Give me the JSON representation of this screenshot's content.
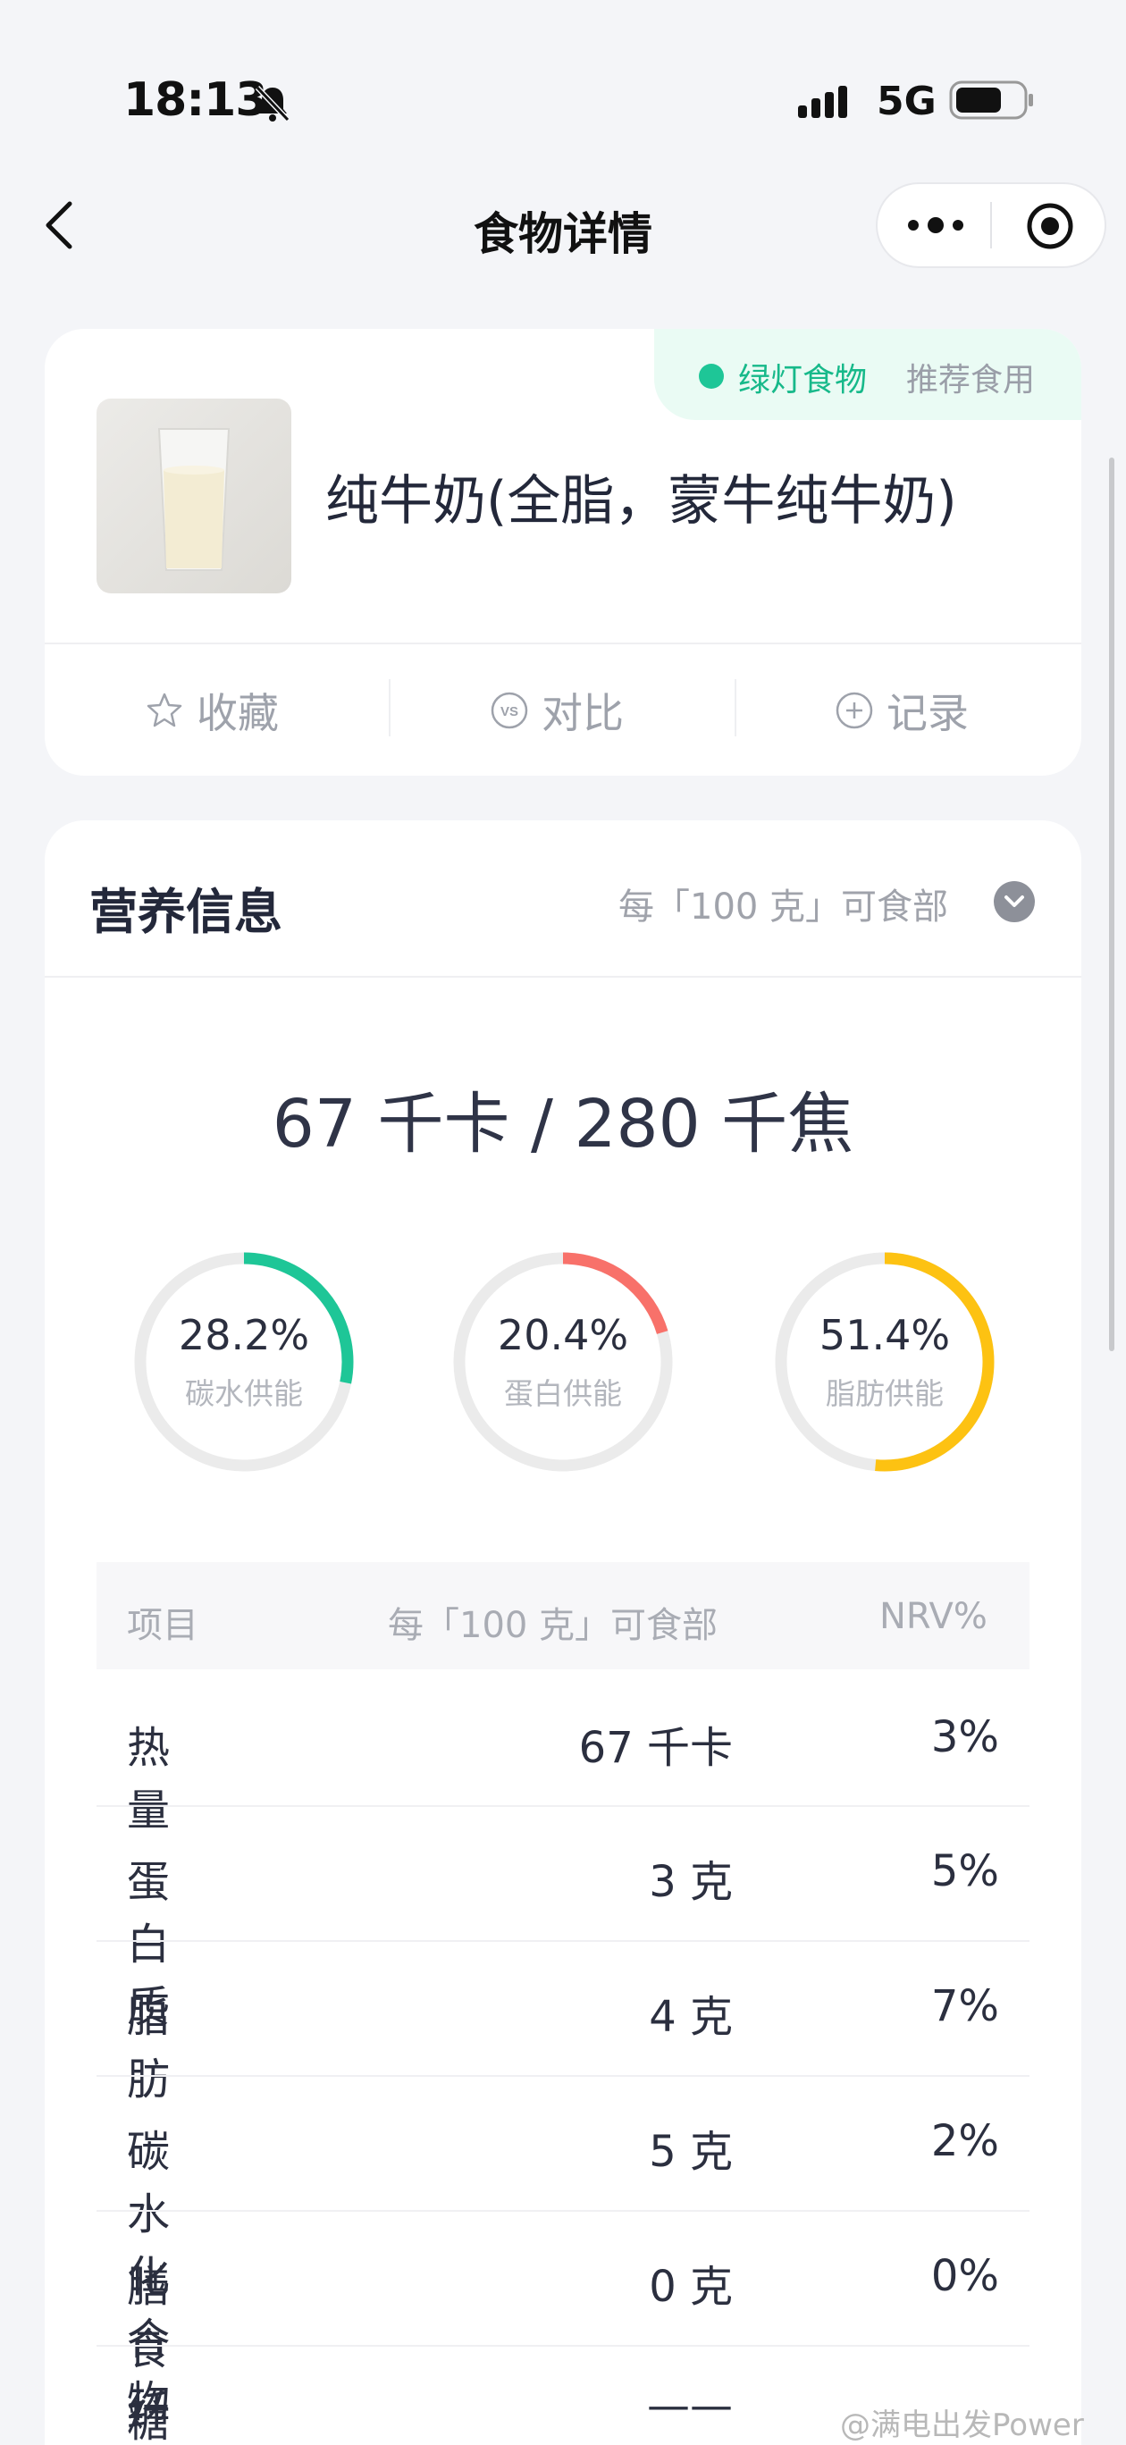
{
  "status_bar": {
    "time": "18:13",
    "network": "5G",
    "icons": [
      "bell-muted-icon",
      "signal-icon",
      "battery-icon"
    ]
  },
  "nav": {
    "title": "食物详情",
    "icons": [
      "back-chevron-icon",
      "more-dots-icon",
      "target-circle-icon"
    ]
  },
  "food": {
    "name": "纯牛奶(全脂，蒙牛纯牛奶)",
    "badge_label": "绿灯食物",
    "badge_note": "推荐食用",
    "badge_color": "#1ec697",
    "actions": [
      {
        "label": "收藏",
        "icon": "star-icon"
      },
      {
        "label": "对比",
        "icon": "vs-icon"
      },
      {
        "label": "记录",
        "icon": "plus-circle-icon"
      }
    ]
  },
  "nutrition": {
    "title": "营养信息",
    "unit_selector": "每「100 克」可食部",
    "energy": "67 千卡 / 280 千焦",
    "rings": [
      {
        "percent": "28.2%",
        "label": "碳水供能",
        "value": 28.2,
        "color": "#1ec697"
      },
      {
        "percent": "20.4%",
        "label": "蛋白供能",
        "value": 20.4,
        "color": "#f8716a"
      },
      {
        "percent": "51.4%",
        "label": "脂肪供能",
        "value": 51.4,
        "color": "#fdc212"
      }
    ],
    "table": {
      "headers": [
        "项目",
        "每「100 克」可食部",
        "NRV%"
      ],
      "rows": [
        {
          "name": "热量",
          "value": "67 千卡",
          "nrv": "3%"
        },
        {
          "name": "蛋白质",
          "value": "3 克",
          "nrv": "5%"
        },
        {
          "name": "脂肪",
          "value": "4 克",
          "nrv": "7%"
        },
        {
          "name": "碳水化合物",
          "value": "5 克",
          "nrv": "2%"
        },
        {
          "name": "膳食纤维",
          "value": "0 克",
          "nrv": "0%"
        },
        {
          "name": "糖",
          "value": "——",
          "nrv": ""
        }
      ]
    }
  },
  "watermark": "@满电出发Power"
}
